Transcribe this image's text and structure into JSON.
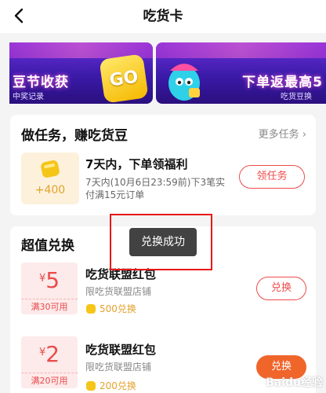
{
  "nav": {
    "title": "吃货卡",
    "back_icon": "chevron-left-icon"
  },
  "banners": [
    {
      "headline": "豆节收获",
      "caption": "中奖记录",
      "badge": "GO"
    },
    {
      "headline": "下单返最高5",
      "caption": "吃货豆换"
    }
  ],
  "tasks": {
    "title": "做任务，赚吃货豆",
    "more": "更多任务 ›",
    "item": {
      "reward": "+400",
      "name": "7天内，下单领福利",
      "desc": "7天内(10月6日23:59前)下3笔实付满15元订单",
      "button": "领任务"
    }
  },
  "exchange": {
    "title": "超值兑换",
    "items": [
      {
        "currency": "¥",
        "amount": "5",
        "condition": "满30可用",
        "name": "吃货联盟红包",
        "sub": "限吃货联盟店铺",
        "price": "500兑换",
        "button": "兑换"
      },
      {
        "currency": "¥",
        "amount": "2",
        "condition": "满20可用",
        "name": "吃货联盟红包",
        "sub": "限吃货联盟店铺",
        "price": "200兑换",
        "button": "兑换"
      }
    ]
  },
  "toast": "兑换成功",
  "colors": {
    "accent": "#ee4b4b",
    "coin": "#f5c518",
    "banner_purple": "#3a1aa8"
  },
  "watermark": "Baidu经验"
}
